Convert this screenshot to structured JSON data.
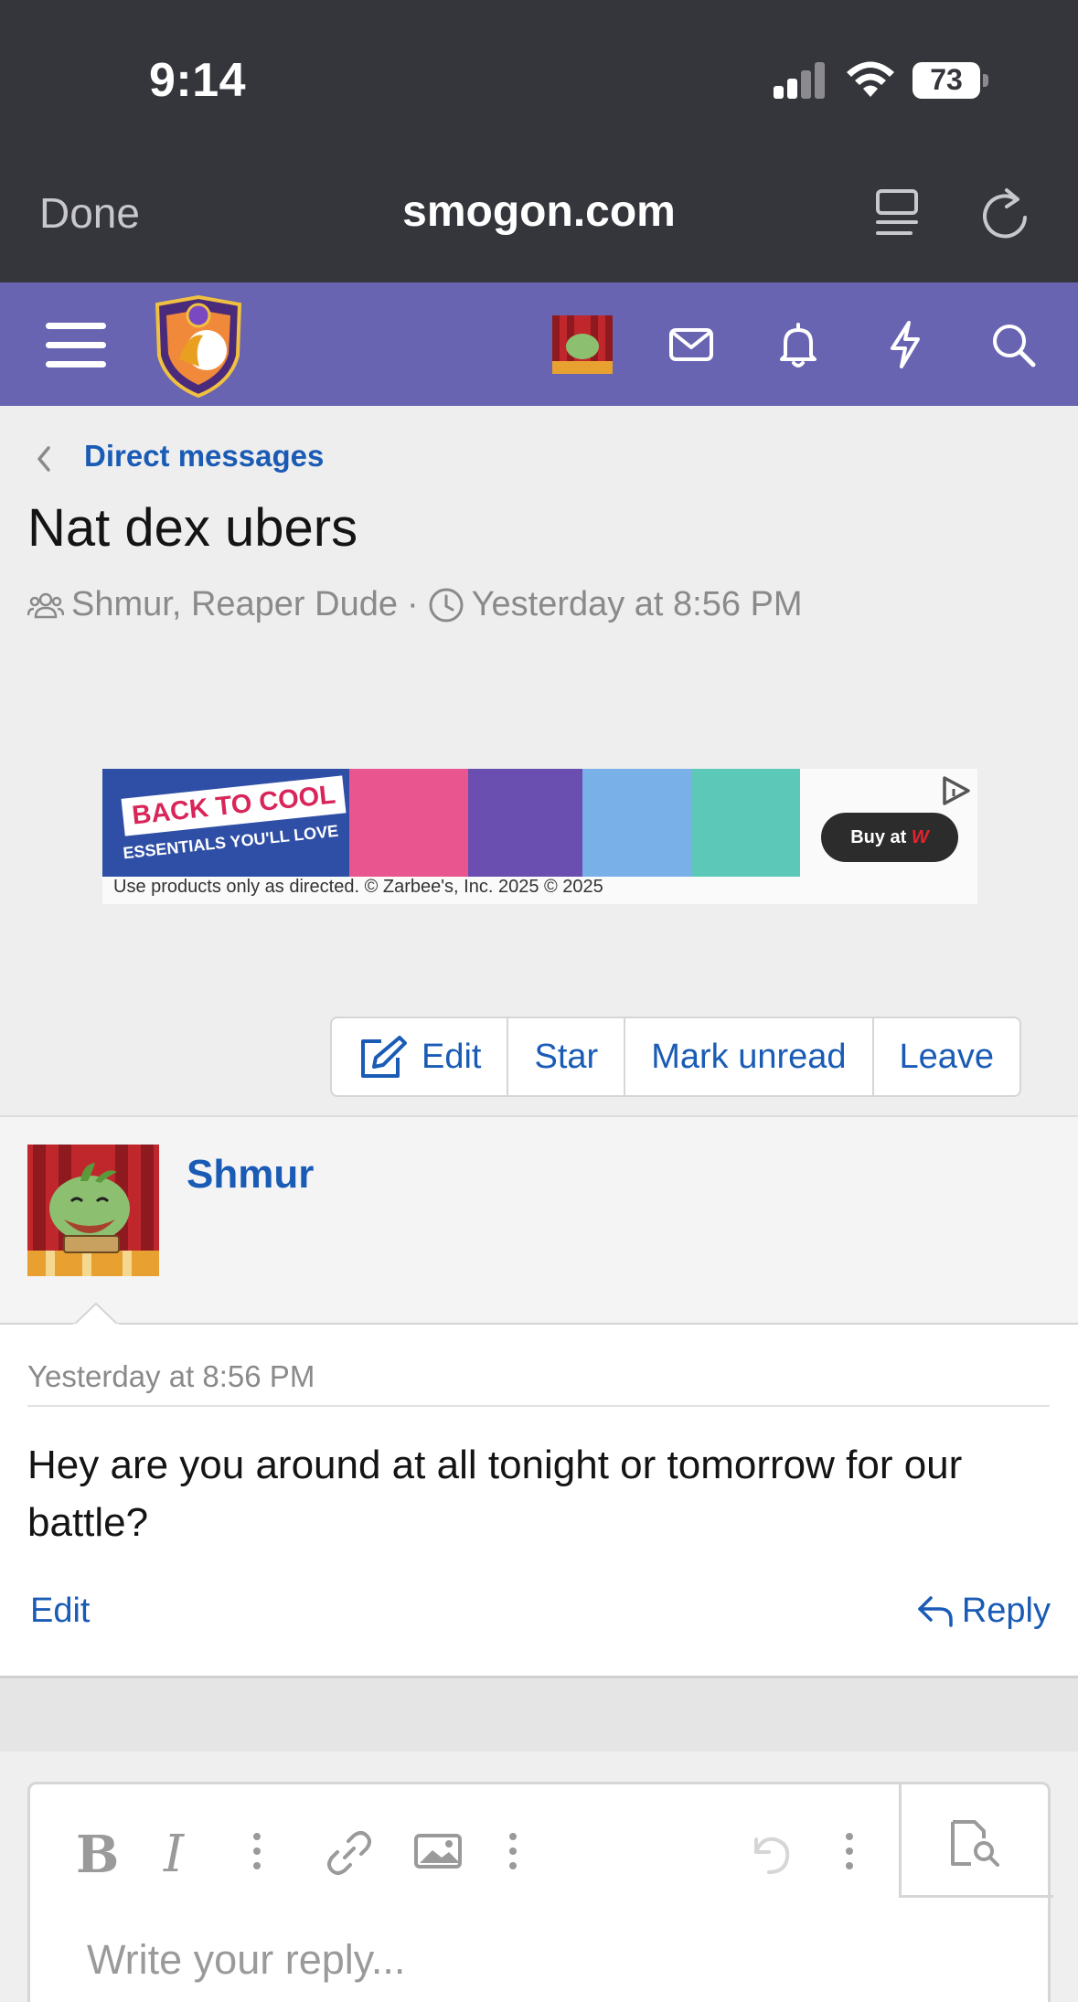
{
  "status_bar": {
    "time": "9:14",
    "battery": "73"
  },
  "browser": {
    "done_label": "Done",
    "domain": "smogon.com"
  },
  "nav": {
    "icons": [
      "menu-icon",
      "site-logo",
      "user-avatar",
      "envelope-icon",
      "bell-icon",
      "bolt-icon",
      "search-icon"
    ],
    "brand_color": "#6864b2"
  },
  "breadcrumb": {
    "label": "Direct messages"
  },
  "conversation": {
    "title": "Nat dex ubers",
    "participants": "Shmur, Reaper Dude",
    "separator": "·",
    "started": "Yesterday at 8:56 PM"
  },
  "ad": {
    "headline": "BACK TO COOL",
    "subline": "ESSENTIALS YOU'LL LOVE",
    "cta": "Buy at",
    "cta_brand": "W",
    "disclaimer": "Use products only as directed. © Zarbee's, Inc. 2025 © 2025"
  },
  "actions": {
    "edit": "Edit",
    "star": "Star",
    "mark_unread": "Mark unread",
    "leave": "Leave"
  },
  "message": {
    "author": "Shmur",
    "date": "Yesterday at 8:56 PM",
    "text": "Hey are you around at all tonight or tomorrow for our battle?",
    "edit_label": "Edit",
    "reply_label": "Reply"
  },
  "editor": {
    "bold": "B",
    "italic": "I",
    "placeholder": "Write your reply..."
  },
  "colors": {
    "link": "#1a5bb5",
    "chrome": "#35363b",
    "text_muted": "#8a8a8a"
  }
}
